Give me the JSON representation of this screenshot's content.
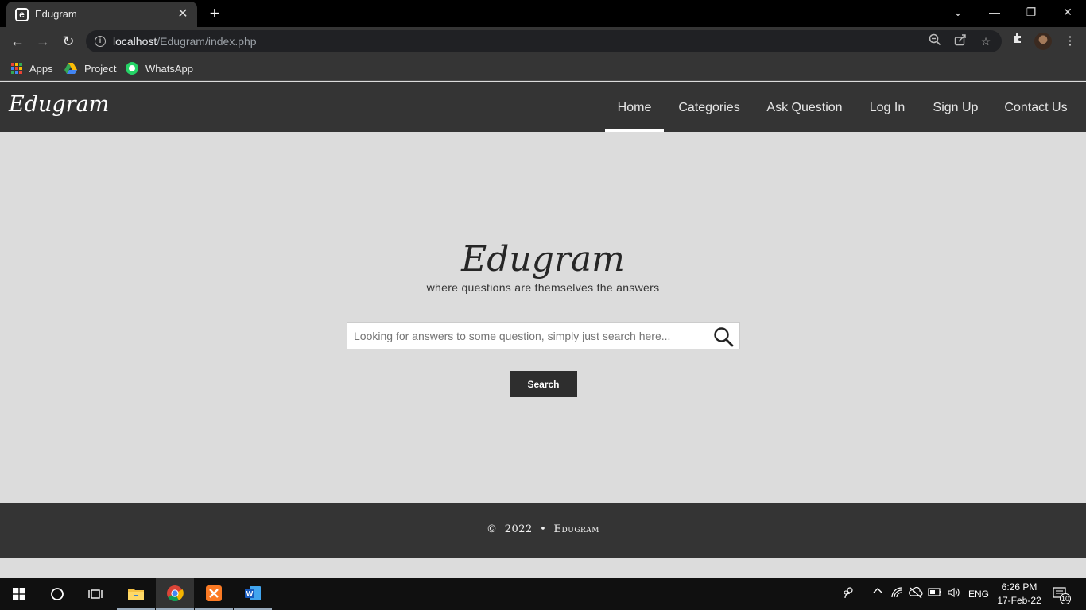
{
  "browser": {
    "tab_title": "Edugram",
    "tab_favicon": "e",
    "tab_close": "✕",
    "new_tab": "+",
    "window_controls": {
      "chevron": "⌄",
      "minimize": "—",
      "restore": "❐",
      "close": "✕"
    },
    "url_host": "localhost",
    "url_path": "/Edugram/index.php",
    "bookmarks": [
      {
        "label": "Apps",
        "icon": "apps-grid-icon"
      },
      {
        "label": "Project",
        "icon": "google-drive-icon"
      },
      {
        "label": "WhatsApp",
        "icon": "whatsapp-icon"
      }
    ]
  },
  "header": {
    "logo": "Edugram",
    "nav": [
      "Home",
      "Categories",
      "Ask Question",
      "Log In",
      "Sign Up",
      "Contact Us"
    ],
    "active_nav": "Home"
  },
  "hero": {
    "title": "Edugram",
    "subtitle": "where questions are themselves the answers",
    "search_placeholder": "Looking for answers to some question, simply just search here...",
    "search_button": "Search"
  },
  "footer": {
    "copyright_symbol": "©",
    "year": "2022",
    "separator": "•",
    "brand": "Edugram"
  },
  "taskbar": {
    "language": "ENG",
    "time": "6:26 PM",
    "date": "17-Feb-22",
    "notifications": "10"
  },
  "colors": {
    "header_bg": "#343434",
    "page_bg": "#dcdcdc",
    "button_bg": "#2e2e2e"
  }
}
